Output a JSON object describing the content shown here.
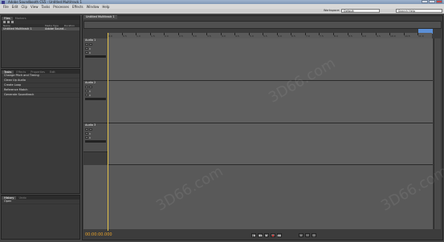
{
  "window": {
    "title": "Adobe Soundbooth CS5 - Untitled Multitrack 1"
  },
  "menu": [
    "File",
    "Edit",
    "Clip",
    "View",
    "Tasks",
    "Processes",
    "Effects",
    "Window",
    "Help"
  ],
  "workspace": {
    "label": "Workspace:",
    "value": "Default"
  },
  "search": {
    "placeholder": "Search Help"
  },
  "files_panel": {
    "tabs": [
      "Files",
      "Markers"
    ],
    "columns": [
      "Name",
      "Media Type",
      "Duration"
    ],
    "rows": [
      {
        "name": "Untitled Multitrack 1",
        "type": "Adobe Sound..."
      }
    ]
  },
  "tasks_panel": {
    "tabs": [
      "Tasks",
      "Effects",
      "Properties",
      "Edit"
    ],
    "items": [
      "Change Pitch and Timing",
      "Clean Up Audio",
      "Create Loop",
      "Reference Match",
      "Generate Soundtrack"
    ]
  },
  "history_panel": {
    "tabs": [
      "History",
      "Undo"
    ],
    "items": [
      "Open"
    ]
  },
  "sequence": {
    "tab_label": "Untitled Multitrack 1",
    "ruler_labels": [
      "0.0",
      "0.5",
      "1.0",
      "1.5",
      "2.0",
      "2.5",
      "3.0",
      "3.5",
      "4.0",
      "4.5",
      "5.0",
      "5.5",
      "6.0",
      "6.5",
      "7.0",
      "7.5",
      "8.0",
      "8.5",
      "9.0",
      "9.5",
      "10.0",
      "10.5",
      "11.0"
    ],
    "tracks": [
      {
        "name": "Audio 1",
        "volume": "0",
        "pan": "0"
      },
      {
        "name": "Audio 2",
        "volume": "0",
        "pan": "0"
      },
      {
        "name": "Audio 3",
        "volume": "0",
        "pan": "0"
      }
    ]
  },
  "transport": {
    "time": "00:00:00.000",
    "buttons": [
      "|◀",
      "◀◀",
      "▶",
      "●",
      "▶▶"
    ],
    "zoom": [
      "+",
      "-",
      "□"
    ]
  },
  "watermarks": [
    "3D66.com",
    "3D66.com",
    "3D66.com"
  ]
}
